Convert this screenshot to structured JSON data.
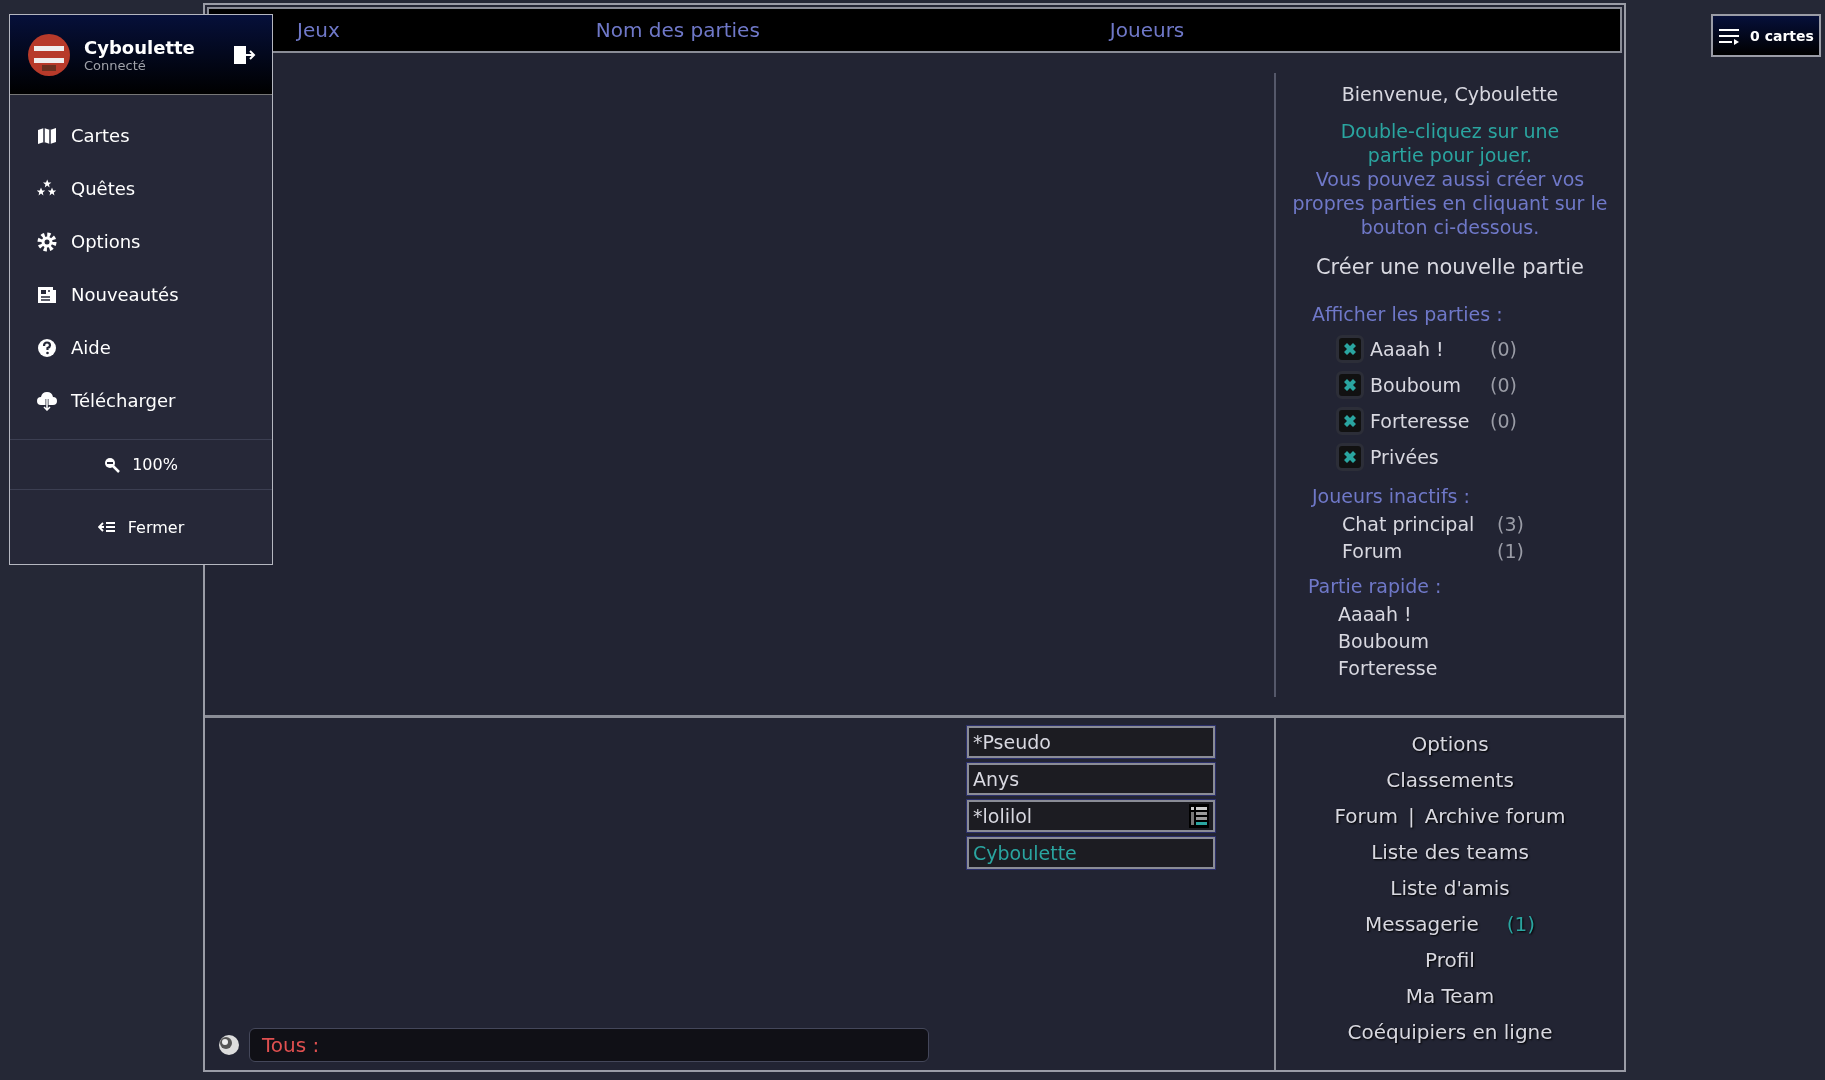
{
  "header_columns": [
    "Jeux",
    "Nom des parties",
    "Joueurs"
  ],
  "side_menu": {
    "user": {
      "name": "Cyboulette",
      "status": "Connecté"
    },
    "items": [
      {
        "label": "Cartes",
        "kind": "map"
      },
      {
        "label": "Quêtes",
        "kind": "stars"
      },
      {
        "label": "Options",
        "kind": "gear"
      },
      {
        "label": "Nouveautés",
        "kind": "news"
      },
      {
        "label": "Aide",
        "kind": "help"
      },
      {
        "label": "Télécharger",
        "kind": "download"
      }
    ],
    "zoom": "100%",
    "close": "Fermer"
  },
  "cards_button": "0 cartes",
  "welcome": {
    "greeting": "Bienvenue, Cyboulette",
    "hint": "Double-cliquez sur une partie pour jouer.",
    "info": "Vous pouvez aussi créer vos propres parties en cliquant sur le bouton ci-dessous.",
    "create": "Créer une nouvelle partie"
  },
  "filters": {
    "title": "Afficher les parties :",
    "items": [
      {
        "label": "Aaaah !",
        "count": "(0)",
        "checked": true
      },
      {
        "label": "Bouboum",
        "count": "(0)",
        "checked": true
      },
      {
        "label": "Forteresse",
        "count": "(0)",
        "checked": true
      },
      {
        "label": "Privées",
        "checked": true
      }
    ]
  },
  "inactive": {
    "title": "Joueurs inactifs :",
    "items": [
      {
        "label": "Chat principal",
        "count": "(3)"
      },
      {
        "label": "Forum",
        "count": "(1)"
      }
    ]
  },
  "quick": {
    "title": "Partie rapide :",
    "items": [
      "Aaaah !",
      "Bouboum",
      "Forteresse"
    ]
  },
  "players": [
    {
      "text": "*Pseudo",
      "kind": "plain",
      "color": "#d8d8e0"
    },
    {
      "text": "Anys",
      "kind": "plain",
      "color": "#d8d8e0"
    },
    {
      "text": "*lolilol",
      "kind": "list",
      "color": "#d8d8e0"
    },
    {
      "text": "Cyboulette",
      "kind": "plain",
      "color": "#2aa5a0"
    }
  ],
  "chat": {
    "channel": "Tous :"
  },
  "menu": [
    {
      "links": [
        "Options"
      ]
    },
    {
      "links": [
        "Classements"
      ]
    },
    {
      "links": [
        "Forum",
        "Archive forum"
      ],
      "separator": "|"
    },
    {
      "links": [
        "Liste des teams"
      ]
    },
    {
      "links": [
        "Liste d'amis"
      ]
    },
    {
      "links": [
        "Messagerie"
      ],
      "count": "(1)"
    },
    {
      "links": [
        "Profil"
      ]
    },
    {
      "links": [
        "Ma Team"
      ]
    },
    {
      "links": [
        "Coéquipiers en ligne"
      ]
    }
  ]
}
